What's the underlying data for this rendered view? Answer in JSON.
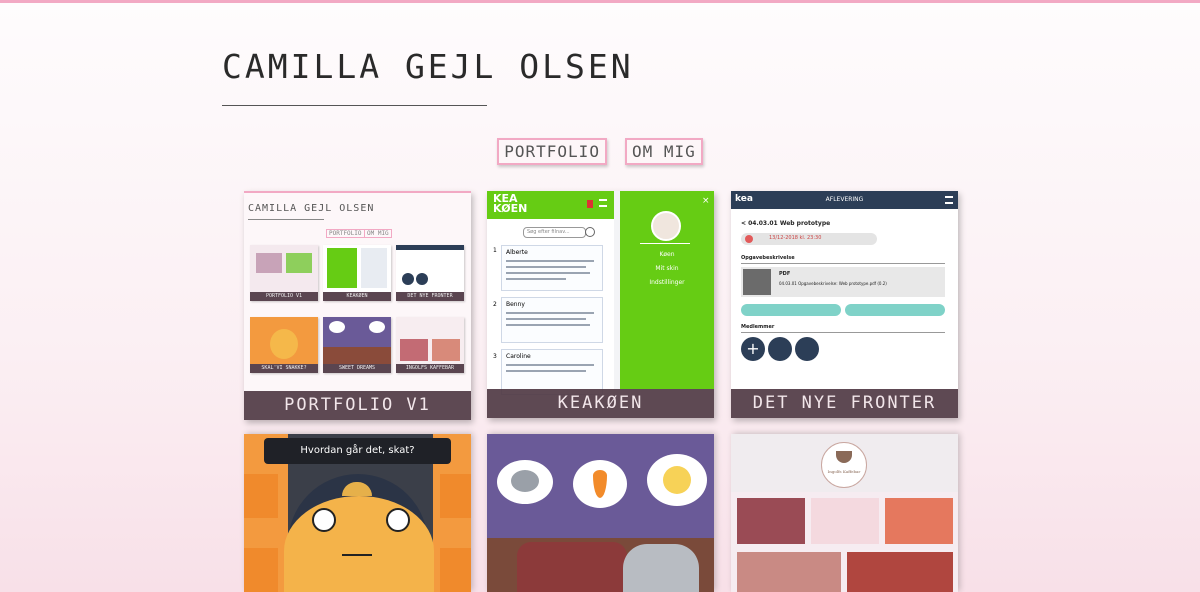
{
  "header": {
    "title": "CAMILLA GEJL OLSEN"
  },
  "nav": {
    "portfolio": "PORTFOLIO",
    "about": "OM MIG"
  },
  "projects": [
    {
      "caption": "PORTFOLIO V1"
    },
    {
      "caption": "KEAKØEN"
    },
    {
      "caption": "DET NYE FRONTER"
    }
  ],
  "thumb_portfolio": {
    "title": "CAMILLA GEJL OLSEN",
    "nav_portfolio": "PORTFOLIO",
    "nav_about": "OM MIG",
    "tiles": [
      "PORTFOLIO V1",
      "KEAKØEN",
      "DET NYE FRONTER",
      "SKAL'VI SNAKKE?",
      "SWEET DREAMS",
      "INGOLFS KAFFEBAR"
    ]
  },
  "thumb_keakoeen": {
    "logo_line1": "KEA",
    "logo_line2": "KØEN",
    "search_placeholder": "Søg efter filnav...",
    "posts": [
      {
        "number": "1",
        "author": "Alberte"
      },
      {
        "number": "2",
        "author": "Benny"
      },
      {
        "number": "3",
        "author": "Caroline"
      }
    ],
    "menu": [
      "Køen",
      "Mit skin",
      "Indstillinger"
    ]
  },
  "thumb_fronter": {
    "header": "AFLEVERING",
    "assignment": "< 04.03.01 Web prototype",
    "deadline": "13/12-2018 kl. 23:30",
    "description_label": "Opgavebeskrivelse",
    "file_type": "PDF",
    "file_name": "04.03.01 Opgavebeskrivelse: Web prototype.pdf (0.2)",
    "members_label": "Medlemmer"
  },
  "thumb_talk": {
    "question": "Hvordan går det, skat?"
  },
  "thumb_cafe": {
    "logo": "Ingolfs Kaffebar"
  },
  "colors": {
    "accent_pink": "#f2a9c4",
    "caption_bg": "#503a44",
    "kea_green": "#66cc14",
    "fronter_navy": "#2c3e57",
    "fronter_teal": "#7fd2c8"
  }
}
